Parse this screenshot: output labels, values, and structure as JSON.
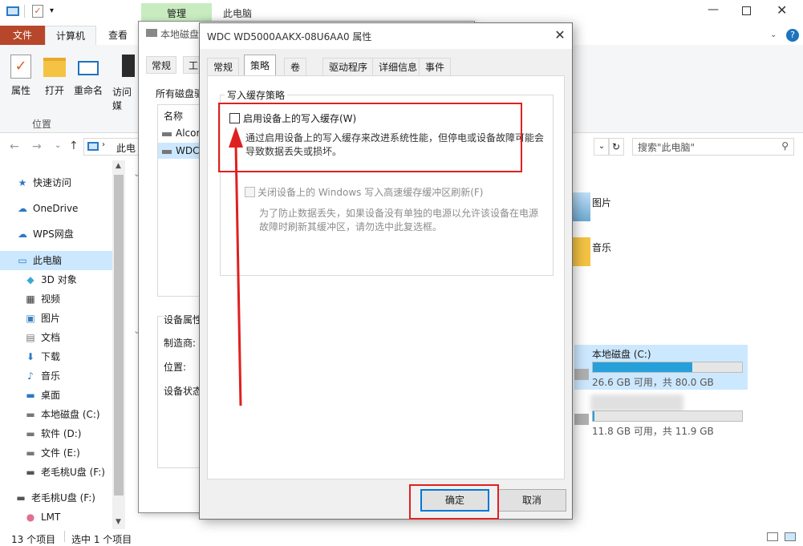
{
  "explorer": {
    "title": "此电脑",
    "manage_tab": "管理",
    "tabs": [
      "文件",
      "计算机",
      "查看"
    ],
    "ribbon_buttons": [
      "属性",
      "打开",
      "重命名",
      "访问媒"
    ],
    "group_label": "位置",
    "address_text": "此电",
    "search_placeholder": "搜索\"此电脑\"",
    "sidebar": [
      {
        "label": "快速访问",
        "icon": "star-icon"
      },
      {
        "label": "OneDrive",
        "icon": "cloud-icon"
      },
      {
        "label": "WPS网盘",
        "icon": "cloud-icon"
      },
      {
        "label": "此电脑",
        "icon": "computer-icon"
      },
      {
        "label": "3D 对象",
        "icon": "cube-icon"
      },
      {
        "label": "视频",
        "icon": "film-icon"
      },
      {
        "label": "图片",
        "icon": "picture-icon"
      },
      {
        "label": "文档",
        "icon": "document-icon"
      },
      {
        "label": "下载",
        "icon": "download-icon"
      },
      {
        "label": "音乐",
        "icon": "music-icon"
      },
      {
        "label": "桌面",
        "icon": "desktop-icon"
      },
      {
        "label": "本地磁盘 (C:)",
        "icon": "drive-icon"
      },
      {
        "label": "软件 (D:)",
        "icon": "drive-icon"
      },
      {
        "label": "文件 (E:)",
        "icon": "drive-icon"
      },
      {
        "label": "老毛桃U盘 (F:)",
        "icon": "usb-drive-icon"
      },
      {
        "label": "老毛桃U盘 (F:)",
        "icon": "usb-drive-icon"
      },
      {
        "label": "LMT",
        "icon": "pig-icon"
      }
    ],
    "folders": [
      {
        "label": "图片"
      },
      {
        "label": "音乐"
      }
    ],
    "drives": [
      {
        "label": "本地磁盘 (C:)",
        "info": "26.6 GB 可用，共 80.0 GB",
        "used_fraction": 0.667
      },
      {
        "label": "",
        "info": "11.8 GB 可用，共 11.9 GB",
        "used_fraction": 0.01
      }
    ],
    "status": {
      "items": "13 个项目",
      "selected": "选中 1 个项目"
    }
  },
  "back_dialog": {
    "title": "本地磁盘",
    "tabs": [
      "常规",
      "工"
    ],
    "all_disks_label": "所有磁盘驱",
    "name_header": "名称",
    "disks": [
      "Alcor",
      "WDC"
    ],
    "device_props": "设备属性",
    "manufacturer": "制造商:",
    "location": "位置:",
    "device_status": "设备状态"
  },
  "dialog": {
    "title": "WDC WD5000AAKX-08U6AA0 属性",
    "tabs": [
      "常规",
      "策略",
      "卷",
      "驱动程序",
      "详细信息",
      "事件"
    ],
    "active_tab": "策略",
    "group_title": "写入缓存策略",
    "enable_cache_label": "启用设备上的写入缓存(W)",
    "enable_cache_checked": false,
    "enable_cache_desc1": "通过启用设备上的写入缓存来改进系统性能，但停电或设备故障可能会",
    "enable_cache_desc2": "导致数据丢失或损坏。",
    "flush_label": "关闭设备上的 Windows 写入高速缓存缓冲区刷新(F)",
    "flush_desc1": "为了防止数据丢失，如果设备没有单独的电源以允许该设备在电源",
    "flush_desc2": "故障时刷新其缓冲区，请勿选中此复选框。",
    "ok": "确定",
    "cancel": "取消"
  }
}
